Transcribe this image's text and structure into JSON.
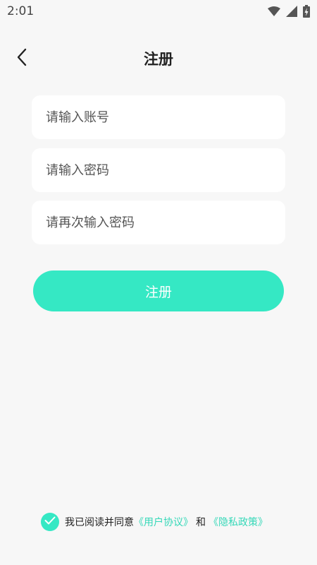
{
  "status_bar": {
    "time": "2:01",
    "icons": [
      "wifi-icon",
      "signal-icon",
      "battery-icon"
    ]
  },
  "header": {
    "title": "注册",
    "back_icon": "chevron-left-icon"
  },
  "form": {
    "account_placeholder": "请输入账号",
    "password_placeholder": "请输入密码",
    "confirm_placeholder": "请再次输入密码",
    "submit_label": "注册"
  },
  "agreement": {
    "checked": true,
    "prefix": "我已阅读并同意",
    "user_agreement": "《用户协议》",
    "conjunction": "和",
    "privacy_policy": "《隐私政策》"
  },
  "colors": {
    "accent": "#35e8c4",
    "background": "#f7f7f7",
    "field": "#ffffff"
  }
}
